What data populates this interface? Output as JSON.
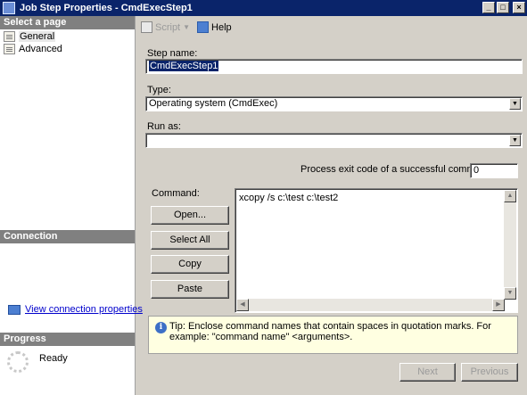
{
  "window": {
    "title": "Job Step Properties - CmdExecStep1"
  },
  "left": {
    "select_page_header": "Select a page",
    "pages": [
      {
        "label": "General",
        "icon": "page-icon"
      },
      {
        "label": "Advanced",
        "icon": "page-icon"
      }
    ],
    "connection_header": "Connection",
    "connection_link": "View connection properties",
    "progress_header": "Progress",
    "progress_status": "Ready"
  },
  "toolbar": {
    "script_label": "Script",
    "help_label": "Help"
  },
  "form": {
    "step_name_label": "Step name:",
    "step_name_value": "CmdExecStep1",
    "type_label": "Type:",
    "type_value": "Operating system (CmdExec)",
    "run_as_label": "Run as:",
    "run_as_value": "",
    "exit_code_label": "Process exit code of a successful command:",
    "exit_code_value": "0",
    "command_label": "Command:",
    "buttons": {
      "open": "Open...",
      "select_all": "Select All",
      "copy": "Copy",
      "paste": "Paste"
    },
    "command_text": "xcopy /s c:\\test c:\\test2",
    "tip": "Tip: Enclose command names that contain spaces in quotation marks. For example: \"command name\" <arguments>."
  },
  "footer": {
    "next": "Next",
    "previous": "Previous"
  },
  "colors": {
    "titlebar": "#0a246a",
    "section_header": "#808080",
    "tip_background": "#ffffe1",
    "link": "#0000cc"
  }
}
